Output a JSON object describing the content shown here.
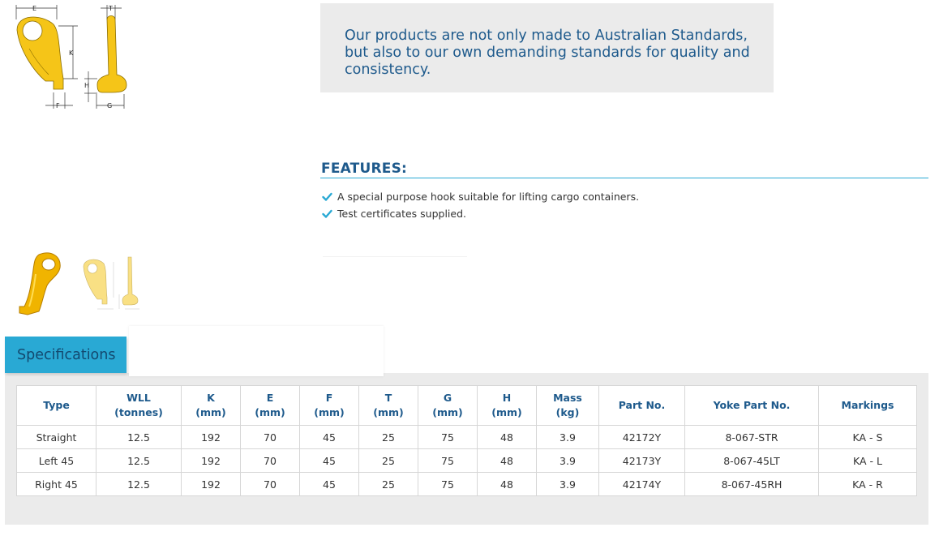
{
  "product_images": {
    "main_diagram": {
      "icon": "hook-dimension-diagram",
      "dimension_labels": [
        "E",
        "T",
        "K",
        "H",
        "F",
        "G"
      ]
    },
    "thumbnails": [
      {
        "icon": "hook-photo-thumbnail"
      },
      {
        "icon": "hook-diagram-thumbnail"
      }
    ]
  },
  "quote": {
    "text": "Our products are not only made to Australian Standards, but also to our own demanding standards for quality and consistency."
  },
  "features": {
    "title": "FEATURES:",
    "items": [
      "A special purpose hook suitable for lifting cargo containers.",
      "Test certificates supplied."
    ]
  },
  "specifications": {
    "tab_label": "Specifications",
    "columns": [
      {
        "l1": "Type",
        "l2": ""
      },
      {
        "l1": "WLL",
        "l2": "(tonnes)"
      },
      {
        "l1": "K",
        "l2": "(mm)"
      },
      {
        "l1": "E",
        "l2": "(mm)"
      },
      {
        "l1": "F",
        "l2": "(mm)"
      },
      {
        "l1": "T",
        "l2": "(mm)"
      },
      {
        "l1": "G",
        "l2": "(mm)"
      },
      {
        "l1": "H",
        "l2": "(mm)"
      },
      {
        "l1": "Mass",
        "l2": "(kg)"
      },
      {
        "l1": "Part No.",
        "l2": ""
      },
      {
        "l1": "Yoke Part No.",
        "l2": ""
      },
      {
        "l1": "Markings",
        "l2": ""
      }
    ],
    "rows": [
      [
        "Straight",
        "12.5",
        "192",
        "70",
        "45",
        "25",
        "75",
        "48",
        "3.9",
        "42172Y",
        "8-067-STR",
        "KA - S"
      ],
      [
        "Left 45",
        "12.5",
        "192",
        "70",
        "45",
        "25",
        "75",
        "48",
        "3.9",
        "42173Y",
        "8-067-45LT",
        "KA - L"
      ],
      [
        "Right 45",
        "12.5",
        "192",
        "70",
        "45",
        "25",
        "75",
        "48",
        "3.9",
        "42174Y",
        "8-067-45RH",
        "KA - R"
      ]
    ]
  },
  "colors": {
    "accent": "#29a9d4",
    "heading": "#1e5a8c",
    "hook_yellow": "#f5c518",
    "panel_bg": "#ebebeb"
  }
}
